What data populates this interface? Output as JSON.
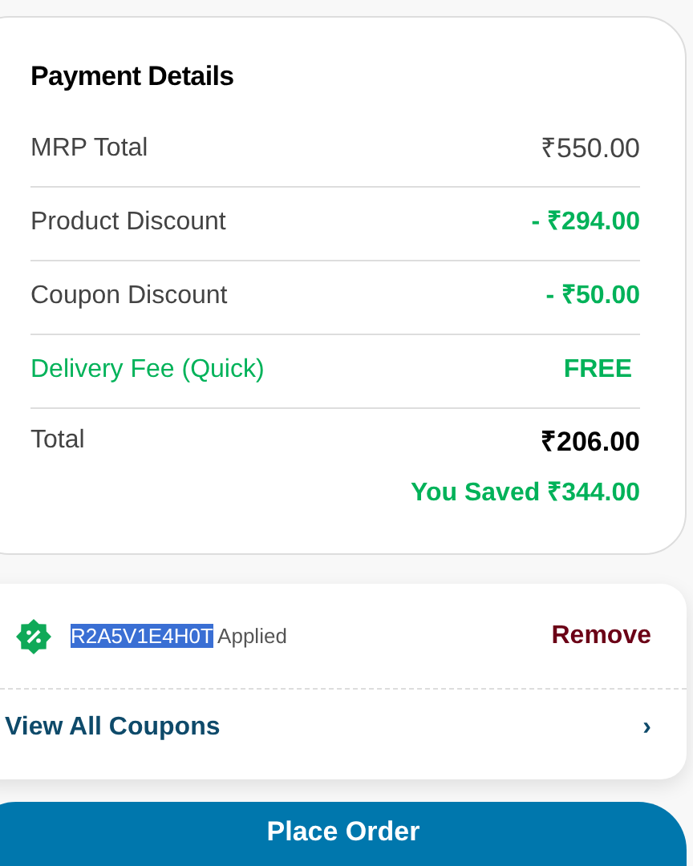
{
  "payment_details": {
    "title": "Payment Details",
    "rows": [
      {
        "label": "MRP Total",
        "value": "₹550.00",
        "kind": "normal"
      },
      {
        "label": "Product Discount",
        "value": "- ₹294.00",
        "kind": "discount"
      },
      {
        "label": "Coupon Discount",
        "value": "- ₹50.00",
        "kind": "discount"
      },
      {
        "label": "Delivery Fee (Quick)",
        "value": "FREE",
        "kind": "free"
      }
    ],
    "total": {
      "label": "Total",
      "value": "₹206.00"
    },
    "savings": "You Saved ₹344.00"
  },
  "coupon": {
    "code": "R2A5V1E4H0T",
    "code_selected": true,
    "status": "Applied",
    "remove": "Remove",
    "view_all": "View All Coupons",
    "chevron": "›"
  },
  "place_order": "Place Order"
}
